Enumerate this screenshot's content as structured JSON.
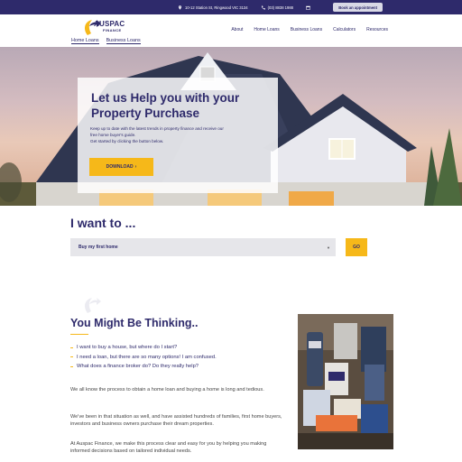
{
  "topbar": {
    "address": "10-12 Station St, Ringwood VIC 3134",
    "phone": "(03) 8838 1988",
    "appointment_button": "Book an appointment"
  },
  "header": {
    "logo_text": "AUSPAC",
    "logo_sub": "FINANCE",
    "sublinks": [
      "Home Loans",
      "Business Loans"
    ],
    "nav": [
      "About",
      "Home Loans",
      "Business Loans",
      "Calculators",
      "Resources"
    ]
  },
  "hero": {
    "title_line1": "Let us Help you with your",
    "title_line2": "Property Purchase",
    "body_line1": "Keep up to date with the latest trends in property finance and receive our",
    "body_line2": "free home buyer's guide.",
    "body_line3": "Get started by clicking the button below.",
    "download_label": "DOWNLOAD",
    "download_icon": "chevron-right-icon"
  },
  "want": {
    "title": "I want to ...",
    "selected": "Buy my first home",
    "go_label": "GO"
  },
  "thinking": {
    "title": "You Might Be Thinking..",
    "bullets": [
      "I want to buy a house, but where do I start?",
      "I need a loan, but there are so many options! I am confused.",
      "What does a finance broker do? Do they really help?"
    ],
    "paragraphs": [
      "We all know the process to obtain a home loan and buying a home is long and tedious.",
      "We've been in that situation as well, and have assisted hundreds of families, first home buyers, investors and business owners purchase their dream properties.",
      "At Auspac Finance, we make this process clear and easy for you by helping you making informed decisions based on tailored individual needs."
    ]
  },
  "colors": {
    "brand_navy": "#2e2a6b",
    "accent_yellow": "#f6b819"
  }
}
